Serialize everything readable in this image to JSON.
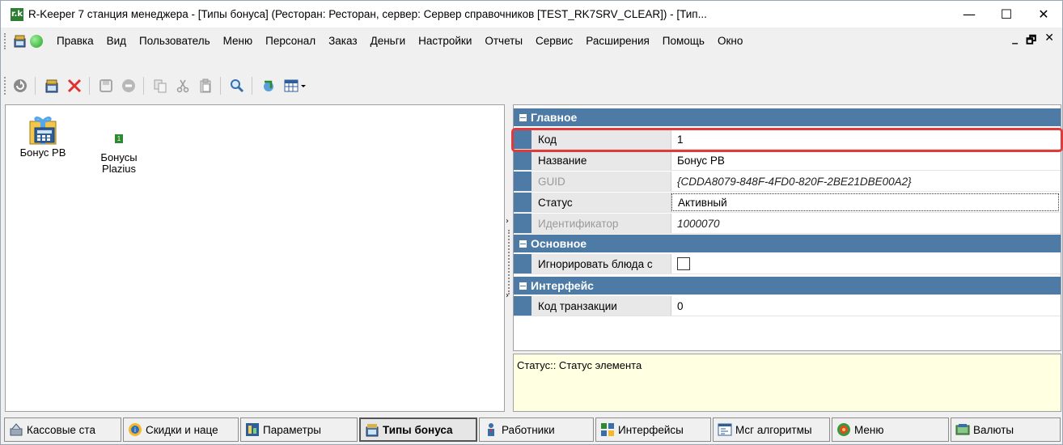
{
  "window": {
    "app_logo": "r.k",
    "title": "R-Keeper 7 станция менеджера - [Типы бонуса] (Ресторан: Ресторан, сервер: Сервер справочников [TEST_RK7SRV_CLEAR]) - [Тип...",
    "minimize_glyph": "—",
    "maximize_glyph": "☐",
    "close_glyph": "✕"
  },
  "menu": {
    "items": [
      "Правка",
      "Вид",
      "Пользователь",
      "Меню",
      "Персонал",
      "Заказ",
      "Деньги",
      "Настройки",
      "Отчеты",
      "Сервис",
      "Расширения",
      "Помощь",
      "Окно"
    ],
    "mdi_minimize": "_",
    "mdi_restore": "🗗",
    "mdi_close": "✕"
  },
  "toolbar": {
    "icons": [
      "refresh-icon",
      "new-item-icon",
      "delete-icon",
      "save-icon",
      "cancel-icon",
      "copy-icon",
      "cut-icon",
      "paste-icon",
      "search-icon",
      "export-icon",
      "view-mode-icon"
    ]
  },
  "left_pane": {
    "items": [
      {
        "label": "Бонус PB",
        "icon": "gift-calculator-icon"
      },
      {
        "label": "Бонусы Plazius",
        "icon": "small-green-icon",
        "small_glyph": "1"
      }
    ]
  },
  "properties": {
    "categories": [
      {
        "name": "Главное",
        "rows": [
          {
            "name": "Код",
            "value": "1"
          },
          {
            "name": "Название",
            "value": "Бонус PB"
          },
          {
            "name": "GUID",
            "value": "{CDDA8079-848F-4FD0-820F-2BE21DBE00A2}"
          },
          {
            "name": "Статус",
            "value": "Активный"
          },
          {
            "name": "Идентификатор",
            "value": "1000070"
          }
        ]
      },
      {
        "name": "Основное",
        "rows": [
          {
            "name": "Игнорировать блюда с",
            "value": ""
          }
        ]
      },
      {
        "name": "Интерфейс",
        "rows": [
          {
            "name": "Код транзакции",
            "value": "0"
          }
        ]
      }
    ],
    "highlight_color": "#e03a3a",
    "category_color": "#4e7aa6"
  },
  "description": "Статус:: Статус элемента",
  "tabs": [
    {
      "label": "Кассовые ста",
      "icon": "cash-register-icon"
    },
    {
      "label": "Скидки и наце",
      "icon": "discount-icon"
    },
    {
      "label": "Параметры",
      "icon": "parameters-icon"
    },
    {
      "label": "Типы бонуса",
      "icon": "bonus-types-icon"
    },
    {
      "label": "Работники",
      "icon": "employee-icon"
    },
    {
      "label": "Интерфейсы",
      "icon": "interfaces-icon"
    },
    {
      "label": "Мсг алгоритмы",
      "icon": "algorithms-icon"
    },
    {
      "label": "Меню",
      "icon": "menu-icon"
    },
    {
      "label": "Валюты",
      "icon": "currency-icon"
    }
  ]
}
